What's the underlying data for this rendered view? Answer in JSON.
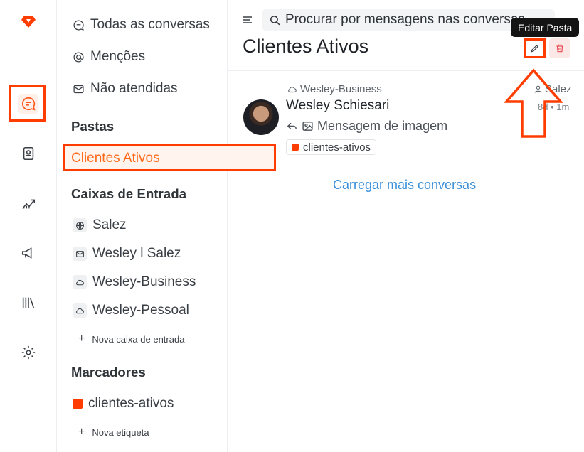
{
  "sidebar": {
    "items": [
      {
        "label": "Todas as conversas",
        "icon": "chat-bubble-icon"
      },
      {
        "label": "Menções",
        "icon": "at-icon"
      },
      {
        "label": "Não atendidas",
        "icon": "mail-open-icon"
      }
    ],
    "folders_heading": "Pastas",
    "folders": [
      {
        "label": "Clientes Ativos"
      }
    ],
    "inboxes_heading": "Caixas de Entrada",
    "inboxes": [
      {
        "label": "Salez",
        "icon": "globe-icon"
      },
      {
        "label": "Wesley l Salez",
        "icon": "mail-icon"
      },
      {
        "label": "Wesley-Business",
        "icon": "cloud-icon"
      },
      {
        "label": "Wesley-Pessoal",
        "icon": "cloud-icon"
      }
    ],
    "new_inbox": "Nova caixa de entrada",
    "labels_heading": "Marcadores",
    "labels": [
      {
        "label": "clientes-ativos",
        "color": "#ff3d00"
      }
    ],
    "new_label": "Nova etiqueta"
  },
  "header": {
    "search_placeholder": "Procurar por mensagens nas conversas",
    "title": "Clientes Ativos",
    "tooltip": "Editar Pasta"
  },
  "conversation": {
    "inbox": "Wesley-Business",
    "assignee": "Salez",
    "contact": "Wesley Schiesari",
    "time": "8d • 1m",
    "preview": "Mensagem de imagem",
    "label": "clientes-ativos"
  },
  "load_more": "Carregar mais conversas",
  "colors": {
    "accent": "#ff3d00",
    "link": "#3a8fd8",
    "highlight": "#ff3d00"
  }
}
